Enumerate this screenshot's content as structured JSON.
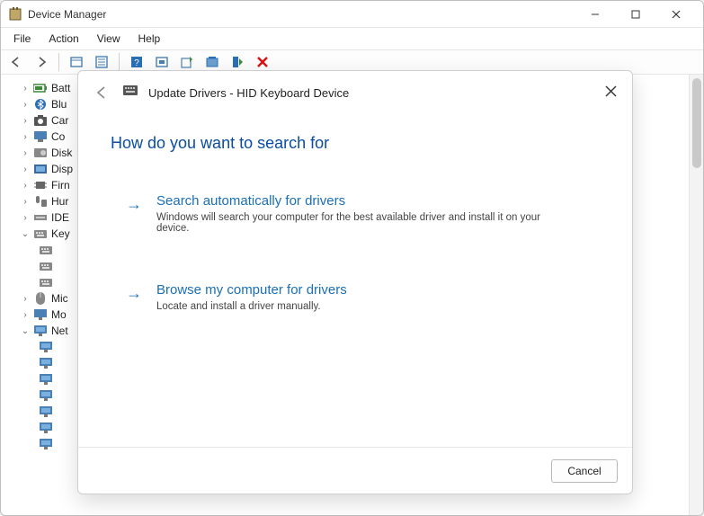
{
  "window": {
    "title": "Device Manager"
  },
  "menubar": [
    "File",
    "Action",
    "View",
    "Help"
  ],
  "tree": {
    "items": [
      {
        "label": "Batt",
        "caret": ">",
        "icon": "battery"
      },
      {
        "label": "Blu",
        "caret": ">",
        "icon": "bluetooth"
      },
      {
        "label": "Car",
        "caret": ">",
        "icon": "camera"
      },
      {
        "label": "Co",
        "caret": ">",
        "icon": "computer"
      },
      {
        "label": "Disk",
        "caret": ">",
        "icon": "disk"
      },
      {
        "label": "Disp",
        "caret": ">",
        "icon": "display"
      },
      {
        "label": "Firn",
        "caret": ">",
        "icon": "firmware"
      },
      {
        "label": "Hur",
        "caret": ">",
        "icon": "hid"
      },
      {
        "label": "IDE",
        "caret": ">",
        "icon": "ide"
      },
      {
        "label": "Key",
        "caret": "v",
        "icon": "keyboard"
      },
      {
        "label": "Mic",
        "caret": ">",
        "icon": "mouse"
      },
      {
        "label": "Mo",
        "caret": ">",
        "icon": "monitor"
      },
      {
        "label": "Net",
        "caret": "v",
        "icon": "network"
      }
    ]
  },
  "dialog": {
    "title": "Update Drivers - HID Keyboard Device",
    "heading": "How do you want to search for",
    "options": [
      {
        "title": "Search automatically for drivers",
        "desc": "Windows will search your computer for the best available driver and install it on your device."
      },
      {
        "title": "Browse my computer for drivers",
        "desc": "Locate and install a driver manually."
      }
    ],
    "cancel": "Cancel"
  }
}
